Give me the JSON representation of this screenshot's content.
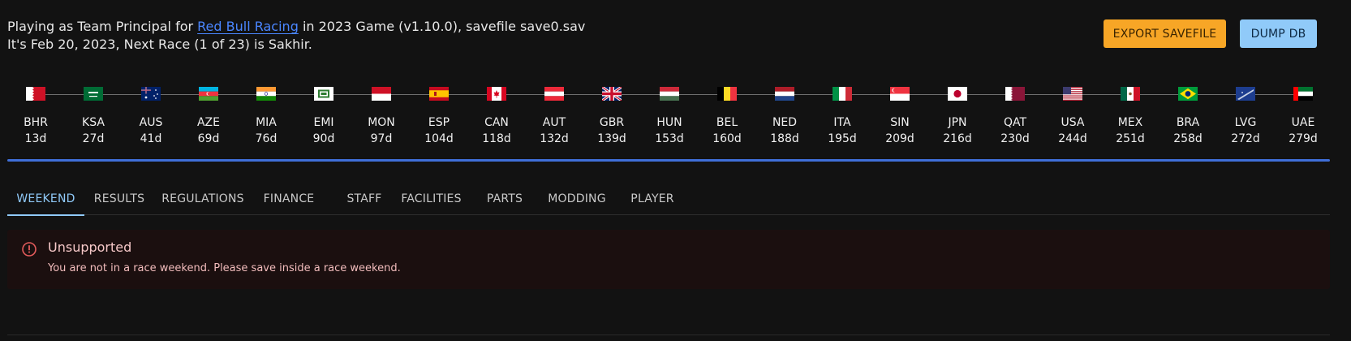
{
  "header": {
    "line1_prefix": "Playing as Team Principal for",
    "team_link": "Red Bull Racing",
    "line1_suffix": "in 2023 Game (v1.10.0), savefile save0.sav",
    "line2": "It's Feb 20, 2023, Next Race (1 of 23) is Sakhir."
  },
  "toolbar": {
    "export_label": "EXPORT SAVEFILE",
    "dump_label": "DUMP DB"
  },
  "colors": {
    "accent": "#90caf9",
    "export_button": "#f7a626",
    "link": "#4a86ff",
    "progress": "#3f6fd8",
    "alert_bg": "#1b0f0f",
    "alert_icon": "#e35b5b"
  },
  "races": [
    {
      "code": "BHR",
      "days": "13d",
      "flag": "bahrain-flag-icon"
    },
    {
      "code": "KSA",
      "days": "27d",
      "flag": "saudi-arabia-flag-icon"
    },
    {
      "code": "AUS",
      "days": "41d",
      "flag": "australia-flag-icon"
    },
    {
      "code": "AZE",
      "days": "69d",
      "flag": "azerbaijan-flag-icon"
    },
    {
      "code": "MIA",
      "days": "76d",
      "flag": "india-flag-icon"
    },
    {
      "code": "EMI",
      "days": "90d",
      "flag": "emilia-romagna-flag-icon"
    },
    {
      "code": "MON",
      "days": "97d",
      "flag": "monaco-flag-icon"
    },
    {
      "code": "ESP",
      "days": "104d",
      "flag": "spain-flag-icon"
    },
    {
      "code": "CAN",
      "days": "118d",
      "flag": "canada-flag-icon"
    },
    {
      "code": "AUT",
      "days": "132d",
      "flag": "austria-flag-icon"
    },
    {
      "code": "GBR",
      "days": "139d",
      "flag": "uk-flag-icon"
    },
    {
      "code": "HUN",
      "days": "153d",
      "flag": "hungary-flag-icon"
    },
    {
      "code": "BEL",
      "days": "160d",
      "flag": "belgium-flag-icon"
    },
    {
      "code": "NED",
      "days": "188d",
      "flag": "netherlands-flag-icon"
    },
    {
      "code": "ITA",
      "days": "195d",
      "flag": "italy-flag-icon"
    },
    {
      "code": "SIN",
      "days": "209d",
      "flag": "singapore-flag-icon"
    },
    {
      "code": "JPN",
      "days": "216d",
      "flag": "japan-flag-icon"
    },
    {
      "code": "QAT",
      "days": "230d",
      "flag": "qatar-flag-icon"
    },
    {
      "code": "USA",
      "days": "244d",
      "flag": "usa-flag-icon"
    },
    {
      "code": "MEX",
      "days": "251d",
      "flag": "mexico-flag-icon"
    },
    {
      "code": "BRA",
      "days": "258d",
      "flag": "brazil-flag-icon"
    },
    {
      "code": "LVG",
      "days": "272d",
      "flag": "las-vegas-flag-icon"
    },
    {
      "code": "UAE",
      "days": "279d",
      "flag": "uae-flag-icon"
    }
  ],
  "tabs": [
    {
      "label": "WEEKEND",
      "active": true
    },
    {
      "label": "RESULTS",
      "active": false
    },
    {
      "label": "REGULATIONS",
      "active": false
    },
    {
      "label": "FINANCE",
      "active": false
    },
    {
      "label": "STAFF",
      "active": false
    },
    {
      "label": "FACILITIES",
      "active": false
    },
    {
      "label": "PARTS",
      "active": false
    },
    {
      "label": "MODDING",
      "active": false
    },
    {
      "label": "PLAYER",
      "active": false
    }
  ],
  "alert": {
    "icon": "error-outline-icon",
    "title": "Unsupported",
    "message": "You are not in a race weekend. Please save inside a race weekend."
  }
}
